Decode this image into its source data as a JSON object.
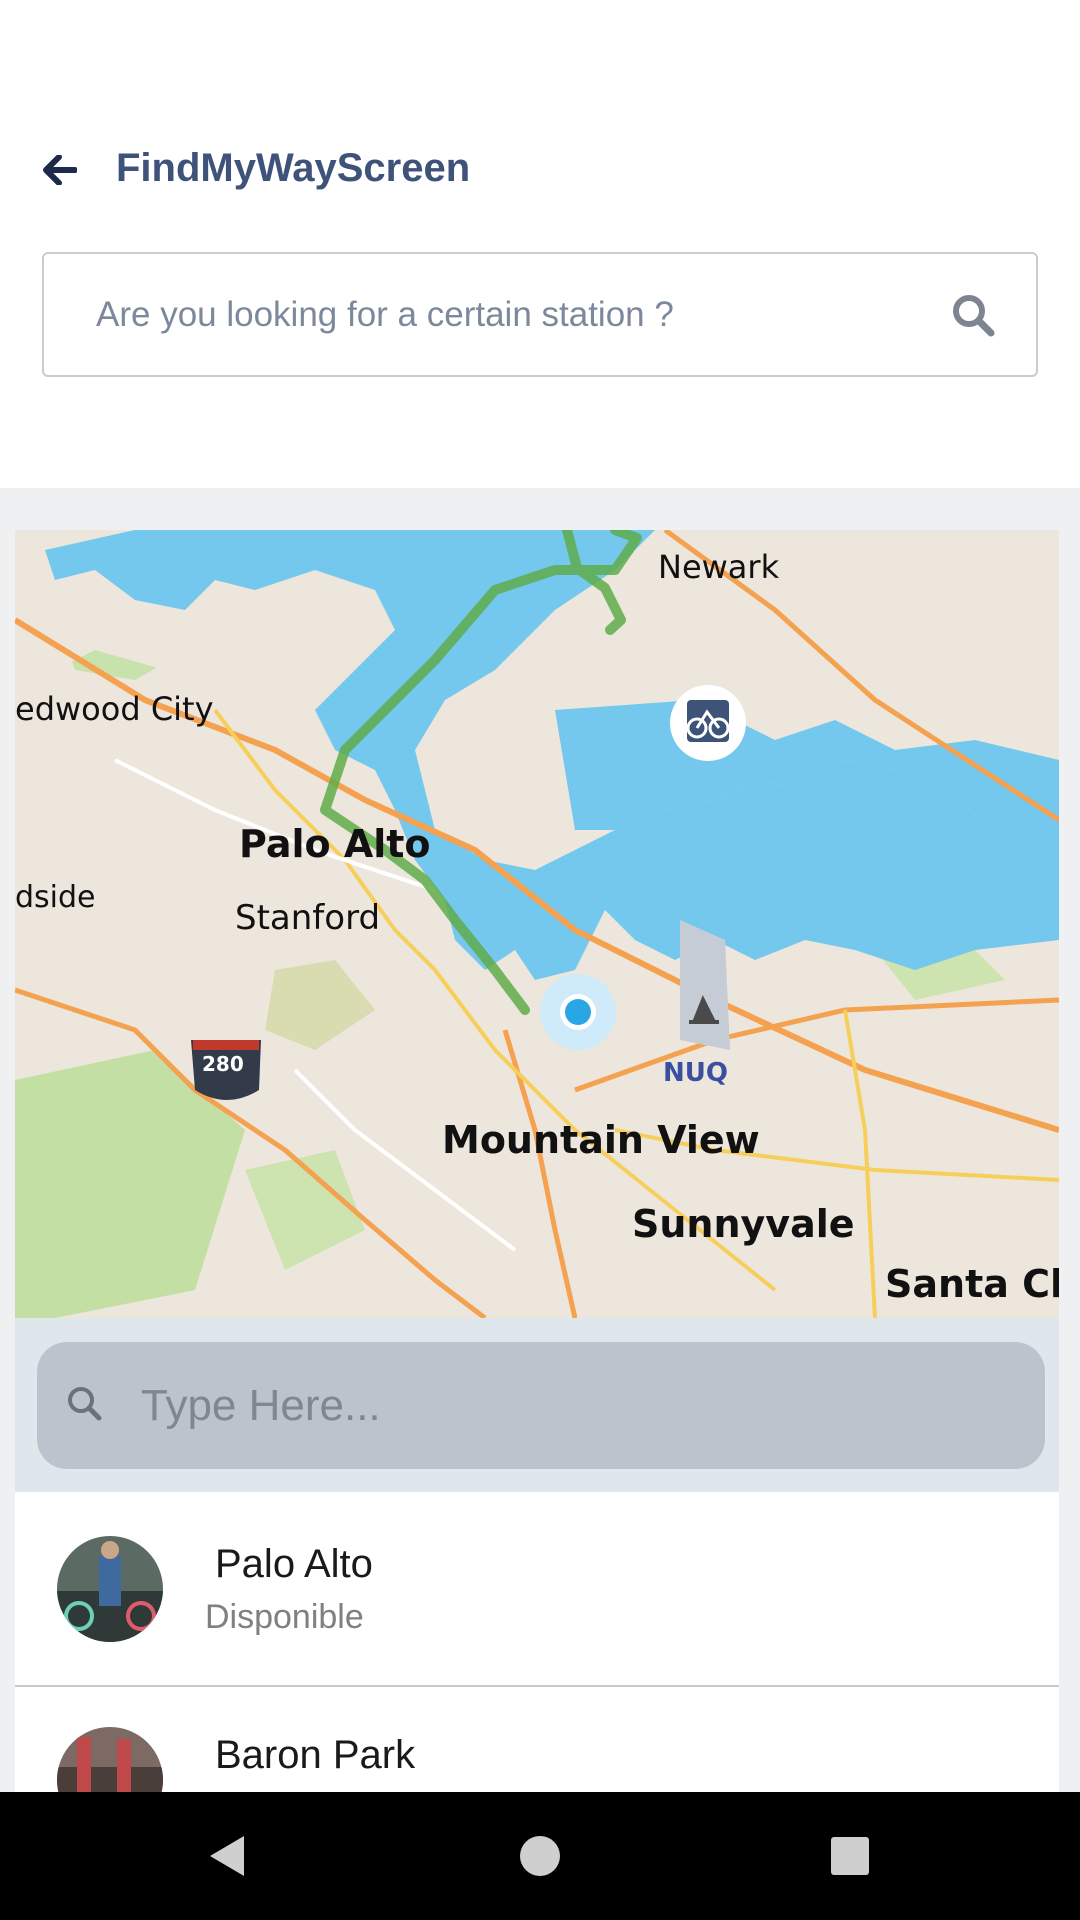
{
  "header": {
    "title": "FindMyWayScreen",
    "search_placeholder": "Are you looking for a certain station ?"
  },
  "map": {
    "labels": {
      "newark": "Newark",
      "redwood_city": "edwood City",
      "palo_alto": "Palo Alto",
      "stanford": "Stanford",
      "woodside": "dside",
      "highway": "280",
      "nuq": "NUQ",
      "mountain_view": "Mountain View",
      "sunnyvale": "Sunnyvale",
      "santa_clara": "Santa Cla"
    },
    "colors": {
      "water": "#74c7ed",
      "route": "#5fab4a",
      "land": "#ede6dd",
      "park": "#c6e0a8",
      "road_major": "#f4a150",
      "road_minor": "#f6cf5a",
      "user_location": "#2ba6e4"
    }
  },
  "station_search": {
    "placeholder": "Type Here..."
  },
  "stations": [
    {
      "name": "Palo Alto",
      "status": "Disponible"
    },
    {
      "name": "Baron Park",
      "status": ""
    }
  ],
  "navbar": {
    "back_icon": "triangle-back-icon",
    "home_icon": "circle-home-icon",
    "recents_icon": "square-recents-icon"
  }
}
